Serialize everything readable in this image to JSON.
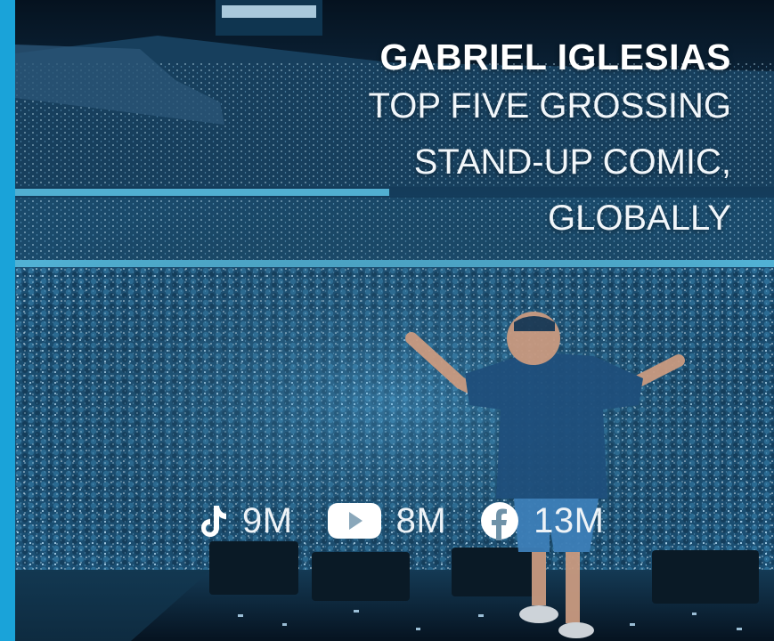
{
  "headline": {
    "name": "GABRIEL IGLESIAS",
    "tagline_lines": [
      "TOP FIVE GROSSING",
      "STAND-UP COMIC,",
      "GLOBALLY"
    ]
  },
  "photo": {
    "subject": "comedian on stage in stadium"
  },
  "social_stats": [
    {
      "platform_icon": "tiktok-icon",
      "count": "9M"
    },
    {
      "platform_icon": "youtube-icon",
      "count": "8M"
    },
    {
      "platform_icon": "facebook-icon",
      "count": "13M"
    }
  ],
  "colors": {
    "accent_bar": "#1aa3d9",
    "crowd_tint": "#2f7fb3",
    "text": "#ffffff"
  }
}
